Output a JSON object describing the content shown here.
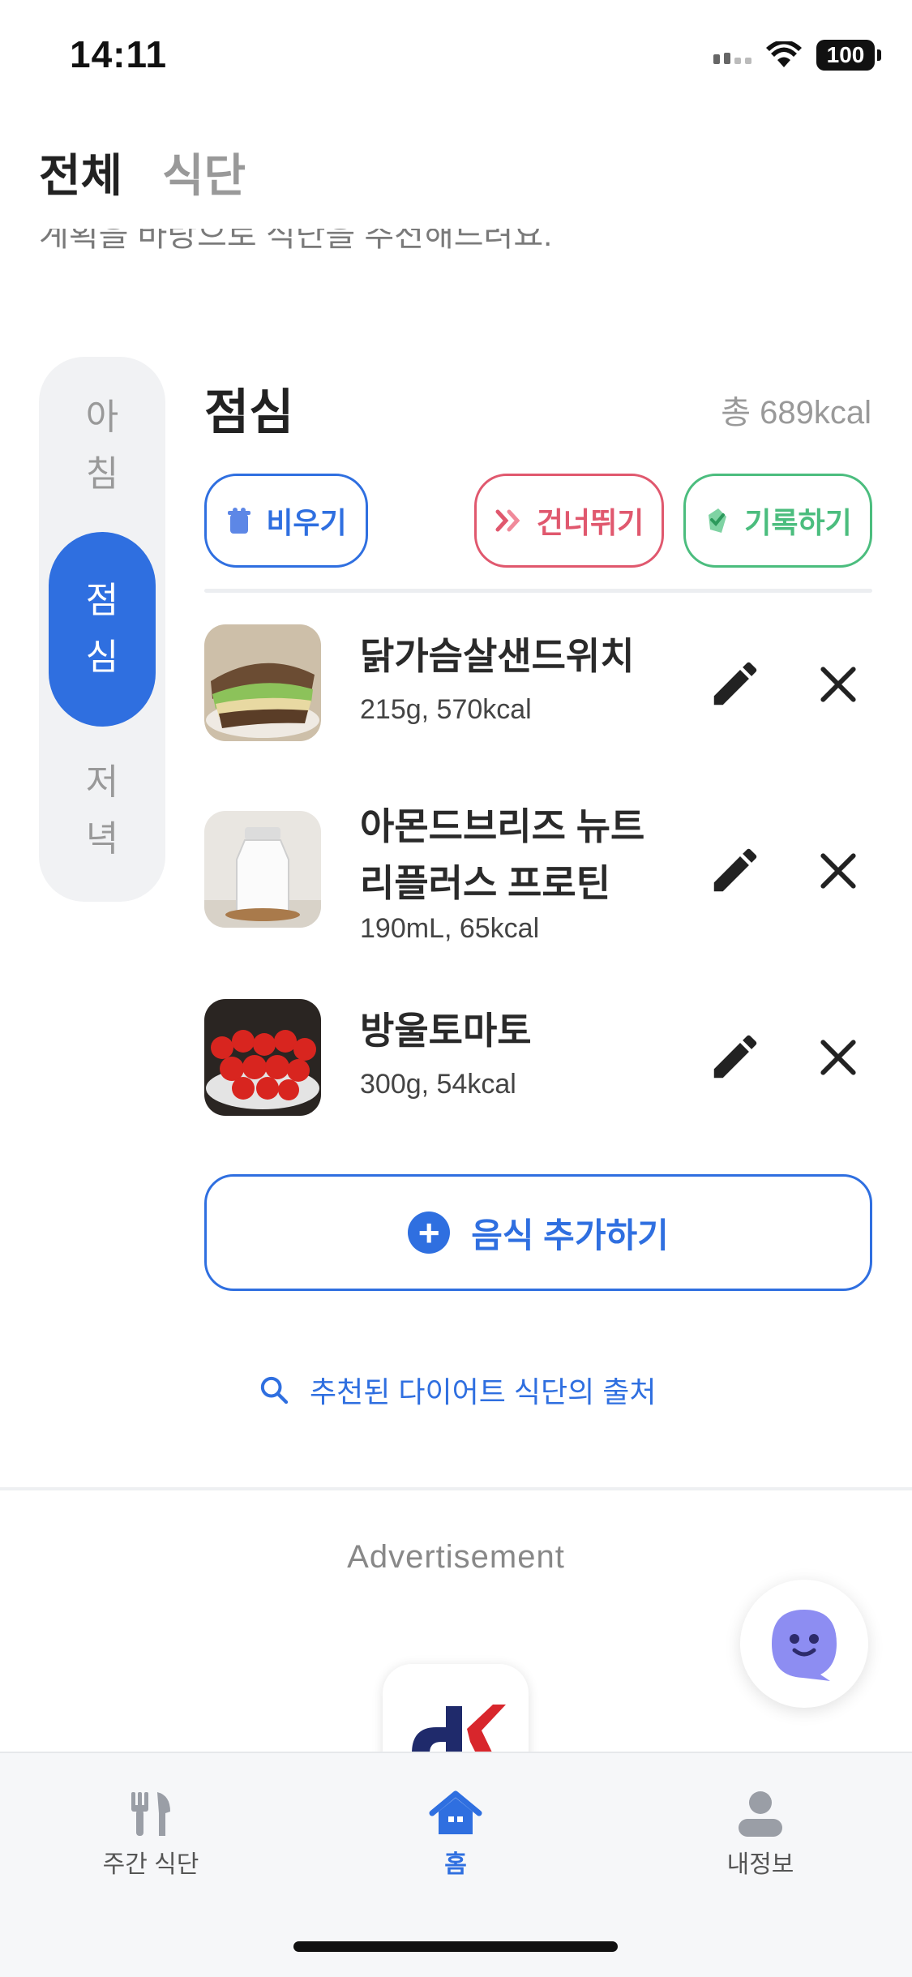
{
  "status": {
    "time": "14:11",
    "battery": "100"
  },
  "header": {
    "tab_all": "전체",
    "tab_meal": "식단"
  },
  "description": "계획을 바탕으로 식단을 추천해드려요.",
  "meal_selector": {
    "items": [
      {
        "label_1": "아",
        "label_2": "침"
      },
      {
        "label_1": "점",
        "label_2": "심"
      },
      {
        "label_1": "저",
        "label_2": "녁"
      }
    ],
    "selected": "점심"
  },
  "section": {
    "title": "점심",
    "total": "총 689kcal"
  },
  "actions": {
    "empty": "비우기",
    "skip": "건너뛰기",
    "record": "기록하기"
  },
  "foods": [
    {
      "name": "닭가슴살샌드위치",
      "detail": "215g, 570kcal"
    },
    {
      "name_line1": "아몬드브리즈 뉴트",
      "name_line2": "리플러스 프로틴",
      "detail": "190mL, 65kcal"
    },
    {
      "name": "방울토마토",
      "detail": "300g, 54kcal"
    }
  ],
  "add_food_label": "음식 추가하기",
  "source_link": "추천된 다이어트 식단의 출처",
  "ad": {
    "label": "Advertisement"
  },
  "nav": {
    "weekly": "주간 식단",
    "home": "홈",
    "profile": "내정보"
  },
  "colors": {
    "accent": "#2f6fe0",
    "skip": "#e0586e",
    "record": "#4bbd7e"
  }
}
